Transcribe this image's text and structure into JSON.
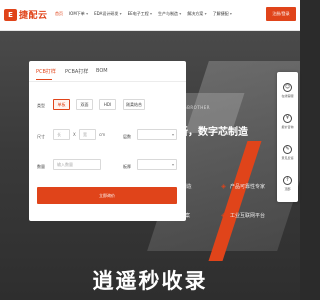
{
  "brand": {
    "logo_mark": "E",
    "name": "捷配云"
  },
  "nav": {
    "items": [
      {
        "label": "首页",
        "chev": ""
      },
      {
        "label": "IOM下单",
        "chev": "▾"
      },
      {
        "label": "EDA设计研发",
        "chev": "▾"
      },
      {
        "label": "EE电子工程",
        "chev": "▾"
      },
      {
        "label": "生产与制造",
        "chev": "▾"
      },
      {
        "label": "解决方案",
        "chev": "▾"
      },
      {
        "label": "了解捷配",
        "chev": "▾"
      }
    ],
    "cta": "注册/登录"
  },
  "hero": {
    "tag": "NGBROTHER",
    "title": "新，数字芯制造",
    "features": [
      "/制造",
      "产品可靠性专家",
      "方案",
      "工业互联网平台"
    ],
    "slogan": "逍遥秒收录"
  },
  "sidebar": {
    "items": [
      {
        "label": "在线客服",
        "icon": "☺"
      },
      {
        "label": "报价咨询",
        "icon": "¥"
      },
      {
        "label": "意见反馈",
        "icon": "✎"
      },
      {
        "label": "顶部",
        "icon": "↑"
      }
    ]
  },
  "quote": {
    "tabs": [
      "PCB打样",
      "PCBA打样",
      "BOM"
    ],
    "layer_label": "类型",
    "layers": [
      "单板",
      "双面",
      "HDI",
      "刚柔结合"
    ],
    "size_label": "尺寸",
    "size_x_placeholder": "长",
    "size_sep": "X",
    "size_y_placeholder": "宽",
    "size_unit": "cm",
    "thickness_label": "层数",
    "qty_label": "数量",
    "qty_placeholder": "输入数量",
    "sheet_label": "板厚",
    "submit": "立即询价"
  },
  "colors": {
    "accent": "#e0441a"
  }
}
